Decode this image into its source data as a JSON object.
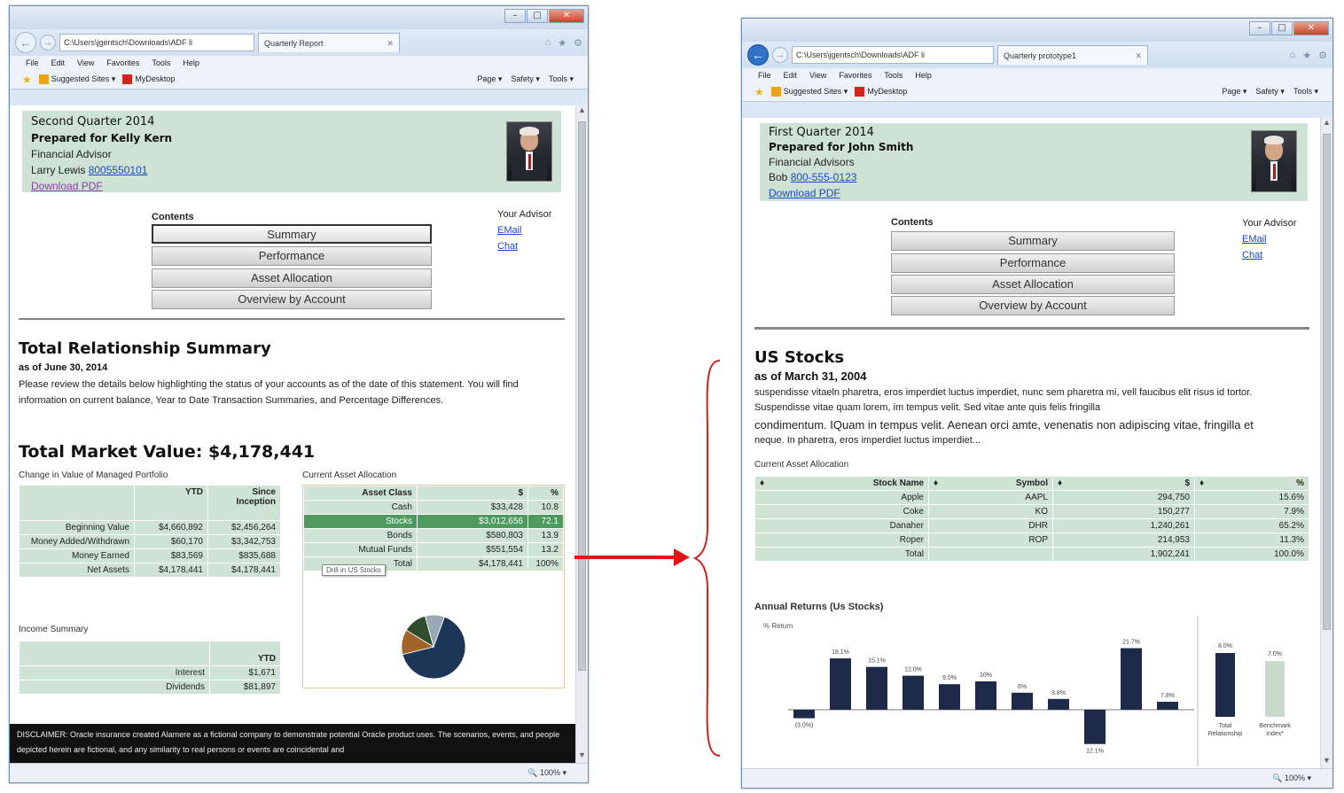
{
  "left": {
    "browser": {
      "address": "C:\\Users\\jgentsch\\Downloads\\ADF li",
      "tab_title": "Quarterly Report",
      "menus": [
        "File",
        "Edit",
        "View",
        "Favorites",
        "Tools",
        "Help"
      ],
      "fav_suggested": "Suggested Sites ▾",
      "fav_mydesktop": "MyDesktop",
      "cmd_page": "Page ▾",
      "cmd_safety": "Safety ▾",
      "cmd_tools": "Tools ▾",
      "zoom": "100%"
    },
    "header": {
      "quarter": "Second Quarter 2014",
      "prepared_for": "Prepared for Kelly Kern",
      "role": "Financial Advisor",
      "advisor_name": "Larry Lewis",
      "phone": "8005550101",
      "download": "Download PDF"
    },
    "contents": {
      "label": "Contents",
      "items": [
        "Summary",
        "Performance",
        "Asset Allocation",
        "Overview by Account"
      ]
    },
    "your_advisor": {
      "label": "Your Advisor",
      "email": "EMail",
      "chat": "Chat"
    },
    "summary": {
      "title": "Total Relationship Summary",
      "as_of": "as of June 30, 2014",
      "paragraph": "Please review the details below highlighting the status of your accounts as of the date of this statement. You will find information on current balance, Year to Date Transaction Summaries, and Percentage Differences.",
      "market_value": "Total Market Value: $4,178,441"
    },
    "change_table": {
      "caption": "Change in Value of Managed Portfolio",
      "headers": [
        "",
        "YTD",
        "Since Inception"
      ],
      "rows": [
        [
          "Beginning Value",
          "$4,660,892",
          "$2,456,264"
        ],
        [
          "Money Added/Withdrawn",
          "$60,170",
          "$3,342,753"
        ],
        [
          "Money Earned",
          "$83,569",
          "$835,688"
        ],
        [
          "Net Assets",
          "$4,178,441",
          "$4,178,441"
        ]
      ]
    },
    "income_table": {
      "caption": "Income Summary",
      "headers": [
        "",
        "YTD"
      ],
      "rows": [
        [
          "Interest",
          "$1,671"
        ],
        [
          "Dividends",
          "$81,897"
        ]
      ]
    },
    "allocation_table": {
      "caption": "Current Asset Allocation",
      "headers": [
        "Asset Class",
        "$",
        "%"
      ],
      "rows": [
        [
          "Cash",
          "$33,428",
          "10.8"
        ],
        [
          "Stocks",
          "$3,012,656",
          "72.1"
        ],
        [
          "Bonds",
          "$580,803",
          "13.9"
        ],
        [
          "Mutual Funds",
          "$551,554",
          "13.2"
        ],
        [
          "Total",
          "$4,178,441",
          "100%"
        ]
      ],
      "tooltip": "Drill in US Stocks"
    },
    "pie": {
      "slices": [
        {
          "label": "Stocks",
          "value": 72.1,
          "color": "#1d3557"
        },
        {
          "label": "Bonds",
          "value": 13.9,
          "color": "#a0642a"
        },
        {
          "label": "Mutual Funds",
          "value": 13.2,
          "color": "#2f4d2c"
        },
        {
          "label": "Cash",
          "value": 10.8,
          "color": "#9aa9b5"
        }
      ]
    },
    "disclaimer": "DISCLAIMER: Oracle insurance created Alamere as a fictional company to demonstrate potential Oracle product uses. The scenarios, events, and people depicted herein are fictional, and any similarity to real persons or events are coincidental and"
  },
  "right": {
    "browser": {
      "address": "C:\\Users\\jgentsch\\Downloads\\ADF li",
      "tab_title": "Quarterly prototype1",
      "menus": [
        "File",
        "Edit",
        "View",
        "Favorites",
        "Tools",
        "Help"
      ],
      "fav_suggested": "Suggested Sites ▾",
      "fav_mydesktop": "MyDesktop",
      "cmd_page": "Page ▾",
      "cmd_safety": "Safety ▾",
      "cmd_tools": "Tools ▾",
      "zoom": "100%"
    },
    "header": {
      "quarter": "First Quarter 2014",
      "prepared_for": "Prepared for John Smith",
      "role": "Financial Advisors",
      "advisor_name": "Bob",
      "phone": "800-555-0123",
      "download": "Download PDF"
    },
    "contents": {
      "label": "Contents",
      "items": [
        "Summary",
        "Performance",
        "Asset Allocation",
        "Overview by Account"
      ]
    },
    "your_advisor": {
      "label": "Your Advisor",
      "email": "EMail",
      "chat": "Chat"
    },
    "stocks": {
      "title": "US Stocks",
      "as_of": "as of March 31, 2004",
      "para1": "suspendisse vitaeln pharetra, eros imperdiet luctus imperdiet, nunc sem pharetra mi, vell faucibus elit risus id tortor. Suspendisse vitae quam lorem, im tempus velit. Sed vitae ante quis felis fringilla",
      "para2": "condimentum. IQuam in tempus velit. Aenean orci amte, venenatis non adipiscing vitae, fringilla et",
      "para3": "neque. In pharetra, eros imperdiet luctus imperdiet..."
    },
    "stock_table": {
      "caption": "Current Asset Allocation",
      "headers": [
        "Stock Name",
        "Symbol",
        "$",
        "%"
      ],
      "rows": [
        [
          "Apple",
          "AAPL",
          "294,750",
          "15.6%"
        ],
        [
          "Coke",
          "KO",
          "150,277",
          "7.9%"
        ],
        [
          "Danaher",
          "DHR",
          "1,240,261",
          "65.2%"
        ],
        [
          "Roper",
          "ROP",
          "214,953",
          "11.3%"
        ],
        [
          "Total",
          "",
          "1,902,241",
          "100.0%"
        ]
      ]
    },
    "annual_caption": "Annual Returns (Us Stocks)"
  },
  "chart_data": [
    {
      "type": "bar",
      "title": "Annual Returns (Us Stocks)",
      "ylabel": "% Return",
      "values": [
        -3.0,
        18.1,
        15.1,
        12.0,
        9.0,
        10.0,
        6.0,
        3.8,
        -12.1,
        21.7,
        2.8
      ],
      "labels": [
        "(3.0%)",
        "18.1%",
        "15.1%",
        "12.0%",
        "9.0%",
        "10%",
        "6%",
        "3.8%",
        "12.1%",
        "21.7%",
        "7.8%"
      ],
      "color": "#1f2a4a"
    },
    {
      "type": "bar",
      "categories": [
        "Total Relationship",
        "Benchmark Index*"
      ],
      "values": [
        8.0,
        7.0
      ],
      "labels": [
        "8.0%",
        "7.0%"
      ],
      "colors": [
        "#1f2a4a",
        "#c9d9cc"
      ]
    }
  ]
}
